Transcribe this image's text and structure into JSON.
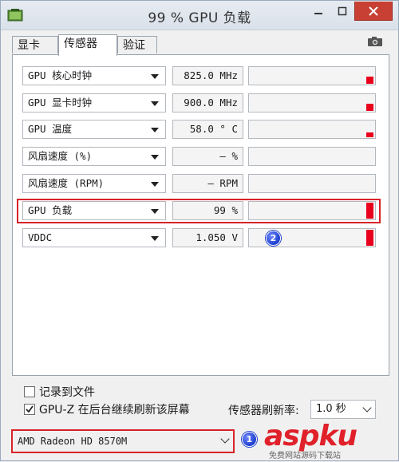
{
  "window": {
    "title": "99 % GPU 负载"
  },
  "tabs": [
    {
      "label": "显卡",
      "active": false
    },
    {
      "label": "传感器",
      "active": true
    },
    {
      "label": "验证",
      "active": false
    }
  ],
  "sensors": [
    {
      "name": "GPU 核心时钟",
      "value": "825.0 MHz",
      "level": 0.45
    },
    {
      "name": "GPU 显卡时钟",
      "value": "900.0 MHz",
      "level": 0.45
    },
    {
      "name": "GPU 温度",
      "value": "58.0 ° C",
      "level": 0.3
    },
    {
      "name": "风扇速度 (%)",
      "value": "— %",
      "level": 0
    },
    {
      "name": "风扇速度 (RPM)",
      "value": "— RPM",
      "level": 0
    },
    {
      "name": "GPU 负载",
      "value": "99 %",
      "level": 0.99
    },
    {
      "name": "VDDC",
      "value": "1.050 V",
      "level": 0.99
    }
  ],
  "options": {
    "log_to_file": {
      "label": "记录到文件",
      "checked": false
    },
    "background_refresh": {
      "label": "GPU-Z 在后台继续刷新该屏幕",
      "checked": true
    }
  },
  "refresh": {
    "label": "传感器刷新率:",
    "value": "1.0 秒"
  },
  "device": {
    "selected": "AMD Radeon HD 8570M"
  },
  "annotations": {
    "badge1": "1",
    "badge2": "2"
  },
  "watermark": {
    "text": "aspku",
    "sub": "免费网站源码下载站"
  },
  "colors": {
    "accent_red": "#d8232a",
    "bar_red": "#e8001c",
    "badge_blue": "#1d3fcf"
  }
}
